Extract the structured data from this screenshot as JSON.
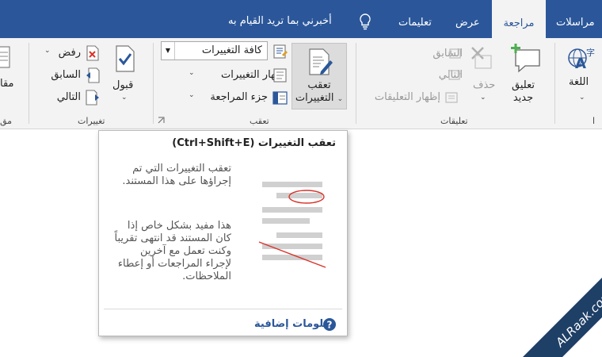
{
  "tabs": {
    "mailings": "مراسلات",
    "review": "مراجعة",
    "view": "عرض",
    "help": "تعليمات"
  },
  "tell_me": "أخبرني بما تريد القيام به",
  "groups": {
    "language": {
      "label": "اللغة",
      "group_label": "ا"
    },
    "comments": {
      "group_label": "تعليقات",
      "new_comment": [
        "تعليق",
        "جديد"
      ],
      "delete": "حذف",
      "previous": "السابق",
      "next": "التالي",
      "show_comments": "إظهار التعليقات"
    },
    "tracking": {
      "group_label": "تعقب",
      "track_changes": [
        "تعقب",
        "التغييرات"
      ],
      "markup_select": "كافة التغييرات",
      "show_markup": "إظهار التغييرات",
      "reviewing_pane": "جزء المراجعة"
    },
    "changes": {
      "group_label": "تغييرات",
      "accept": "قبول",
      "reject": "رفض",
      "previous": "السابق",
      "next": "التالي"
    },
    "compare": {
      "label": "مقا",
      "group_label": "مق"
    }
  },
  "tooltip": {
    "title": "تعقب التغييرات (Ctrl+Shift+E)",
    "para1": "تعقب التغييرات التي تم إجراؤها على هذا المستند.",
    "para2": "هذا مفيد بشكل خاص إذا كان المستند قد انتهى تقريباً وكنت تعمل مع آخرين لإجراء المراجعات أو إعطاء الملاحظات.",
    "more_info": "معلومات إضافية"
  },
  "watermark": "ALRaak.com",
  "colors": {
    "tabbar": "#2b579a",
    "ribbon": "#f3f3f3",
    "accent_green": "#4caf50",
    "accent_red": "#d9342b",
    "link_blue": "#2b579a"
  }
}
